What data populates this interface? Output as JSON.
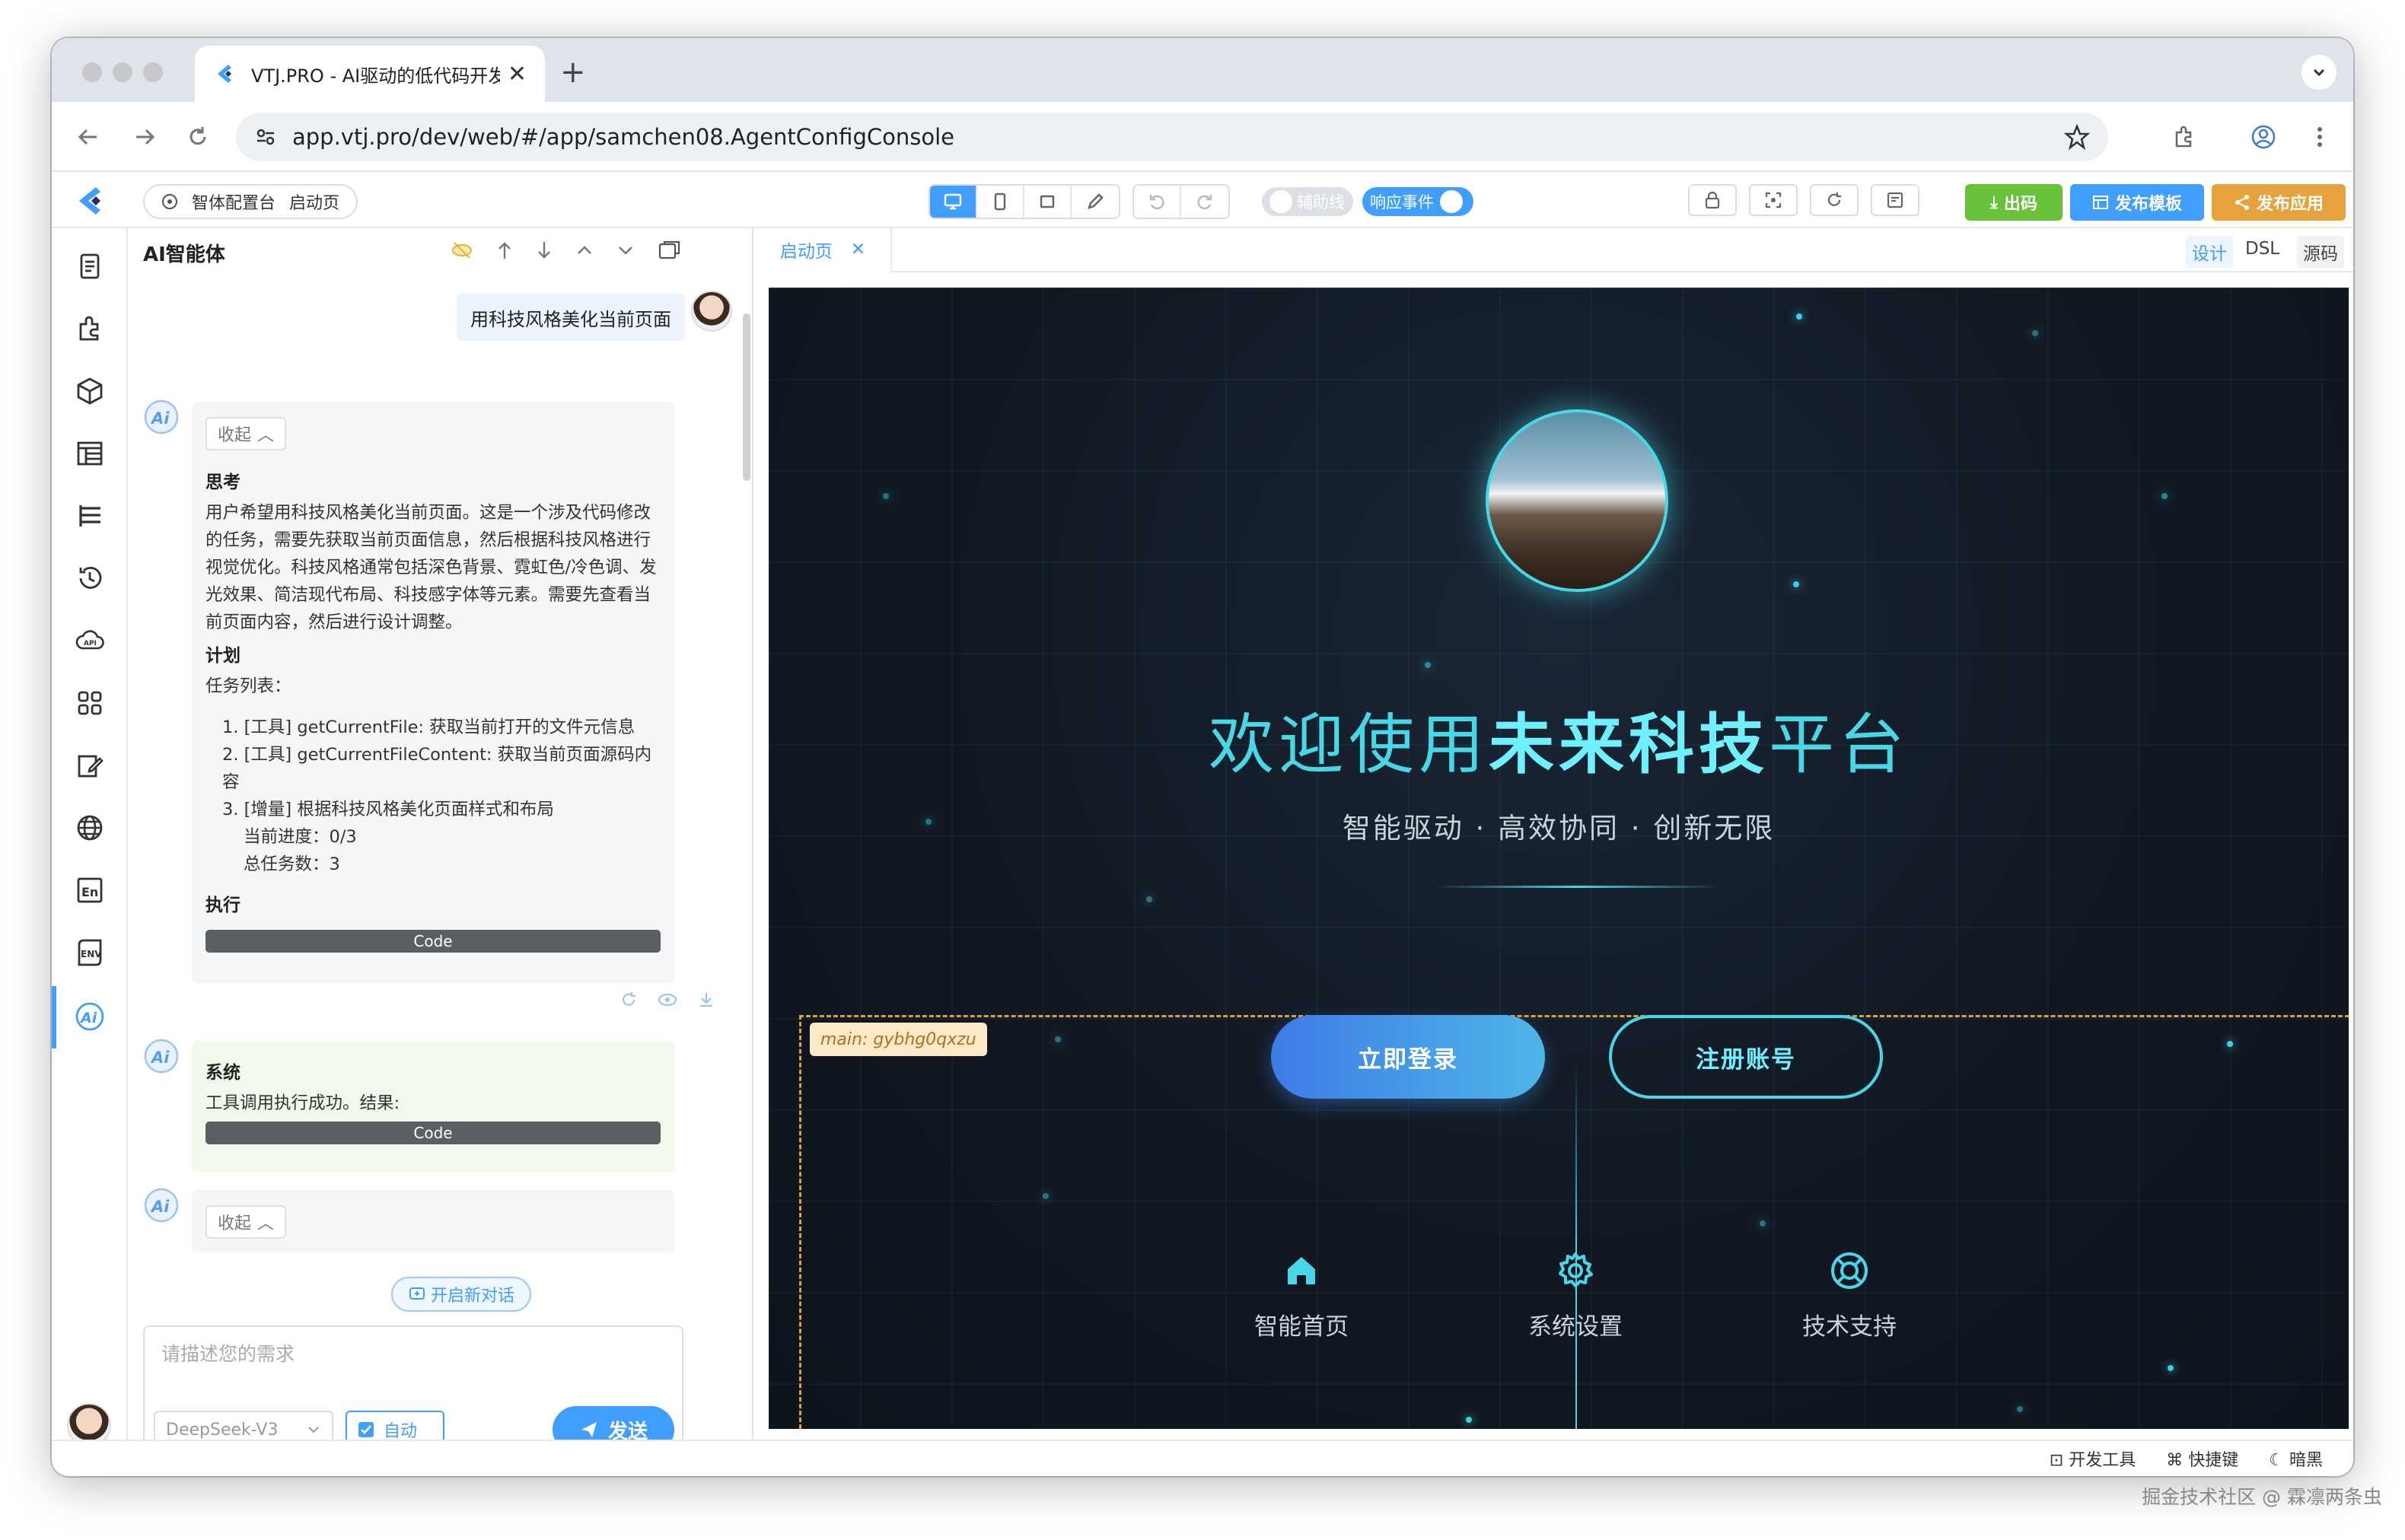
{
  "browser": {
    "tab_title": "VTJ.PRO - AI驱动的低代码开发",
    "url": "app.vtj.pro/dev/web/#/app/samchen08.AgentConfigConsole"
  },
  "app": {
    "breadcrumb": {
      "app": "智体配置台",
      "page": "启动页"
    },
    "toggles": {
      "guide": "辅助线",
      "events": "响应事件"
    },
    "buttons": {
      "export": "出码",
      "publish_template": "发布模板",
      "publish_app": "发布应用"
    }
  },
  "ai": {
    "title": "AI智能体",
    "user_message": "用科技风格美化当前页面",
    "collapse_label": "收起",
    "think_title": "思考",
    "think_text": "用户希望用科技风格美化当前页面。这是一个涉及代码修改的任务，需要先获取当前页面信息，然后根据科技风格进行视觉优化。科技风格通常包括深色背景、霓虹色/冷色调、发光效果、简洁现代布局、科技感字体等元素。需要先查看当前页面内容，然后进行设计调整。",
    "plan_title": "计划",
    "task_list_label": "任务列表：",
    "tasks": [
      "1. [工具] getCurrentFile: 获取当前打开的文件元信息",
      "2. [工具] getCurrentFileContent: 获取当前页面源码内容",
      "3. [增量] 根据科技风格美化页面样式和布局"
    ],
    "progress": "当前进度：0/3",
    "total": "总任务数：3",
    "exec_title": "执行",
    "code_label": "Code",
    "system_title": "系统",
    "system_text": "工具调用执行成功。结果:",
    "new_chat": "开启新对话",
    "input_placeholder": "请描述您的需求",
    "model": "DeepSeek-V3",
    "auto": "自动",
    "send": "发送"
  },
  "editor": {
    "tab": "启动页",
    "modes": [
      "设计",
      "DSL",
      "源码"
    ]
  },
  "preview": {
    "title_pre": "欢迎使用",
    "title_bold": "未来科技",
    "title_post": "平台",
    "subtitle": "智能驱动 · 高效协同 · 创新无限",
    "main_tag": "main: gybhg0qxzu",
    "login": "立即登录",
    "register": "注册账号",
    "nav": [
      "智能首页",
      "系统设置",
      "技术支持"
    ]
  },
  "status": {
    "devtools": "开发工具",
    "shortcuts": "快捷键",
    "dark": "暗黑"
  },
  "watermark": "掘金技术社区 @ 霖凛两条虫",
  "colors": {
    "accent": "#409eff",
    "neon": "#47d7e6",
    "export": "#67c23a",
    "publish_app": "#e6a23c"
  }
}
